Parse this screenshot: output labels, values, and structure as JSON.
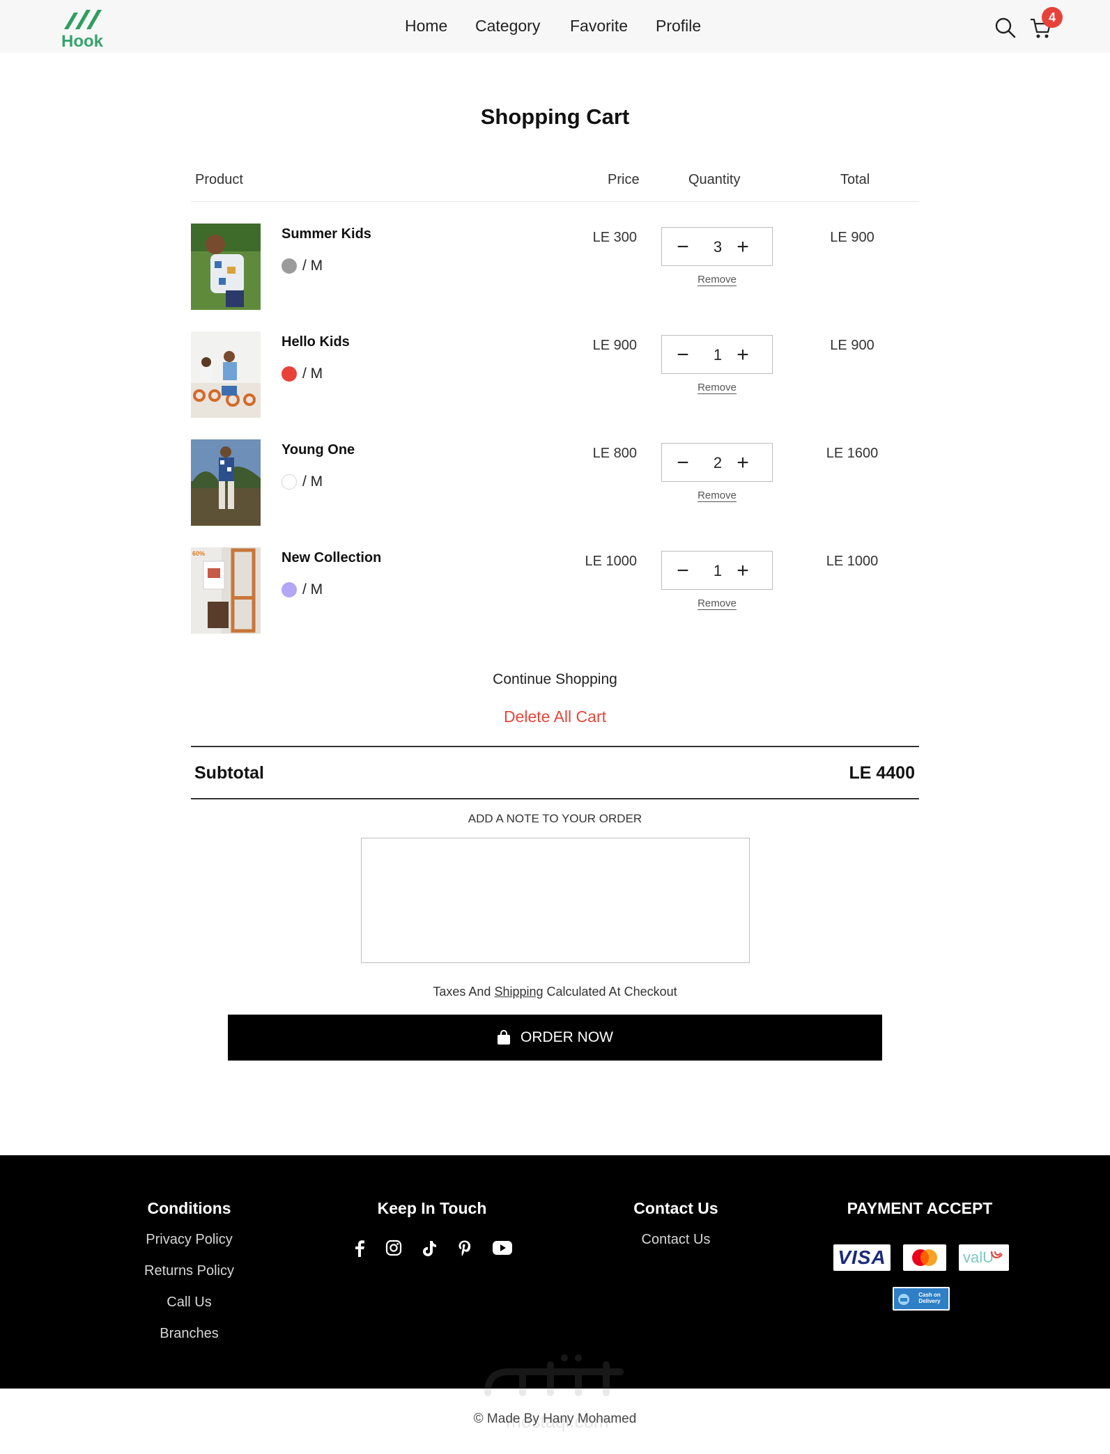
{
  "header": {
    "logo_text": "Hook",
    "nav": [
      "Home",
      "Category",
      "Favorite",
      "Profile"
    ],
    "cart_count": "4",
    "icons": [
      "search-icon",
      "cart-icon"
    ],
    "badge_color": "#e8413a",
    "brand_color": "#35a36a"
  },
  "cart": {
    "title": "Shopping Cart",
    "columns": {
      "product": "Product",
      "price": "Price",
      "quantity": "Quantity",
      "total": "Total"
    },
    "remove_label": "Remove",
    "items": [
      {
        "name": "Summer Kids",
        "color": "#9b9b9b",
        "size": "/ M",
        "price": "LE 300",
        "qty": "3",
        "total": "LE 900"
      },
      {
        "name": "Hello Kids",
        "color": "#e8413a",
        "size": "/ M",
        "price": "LE 900",
        "qty": "1",
        "total": "LE 900"
      },
      {
        "name": "Young One",
        "color": "#ffffff",
        "size": "/ M",
        "price": "LE 800",
        "qty": "2",
        "total": "LE 1600"
      },
      {
        "name": "New Collection",
        "color": "#b3a6f5",
        "size": "/ M",
        "price": "LE 1000",
        "qty": "1",
        "total": "LE 1000"
      }
    ],
    "continue_label": "Continue Shopping",
    "delete_label": "Delete All Cart",
    "subtotal_label": "Subtotal",
    "subtotal_value": "LE 4400",
    "note_label": "ADD A NOTE TO YOUR ORDER",
    "note_value": "",
    "tax_before": "Taxes And ",
    "tax_link": "Shipping",
    "tax_after": " Calculated At Checkout",
    "order_label": "ORDER NOW"
  },
  "footer": {
    "conditions": {
      "heading": "Conditions",
      "links": [
        "Privacy Policy",
        "Returns Policy",
        "Call Us",
        "Branches"
      ]
    },
    "touch": {
      "heading": "Keep In Touch",
      "icons": [
        "facebook-icon",
        "instagram-icon",
        "tiktok-icon",
        "pinterest-icon",
        "youtube-icon"
      ]
    },
    "contact": {
      "heading": "Contact Us",
      "links": [
        "Contact Us"
      ]
    },
    "payment": {
      "heading": "PAYMENT ACCEPT",
      "methods": [
        "VISA",
        "Mastercard",
        "valU",
        "Cash on Delivery"
      ]
    },
    "credit": "© Made By Hany Mohamed",
    "watermark": "mostaql.com"
  }
}
